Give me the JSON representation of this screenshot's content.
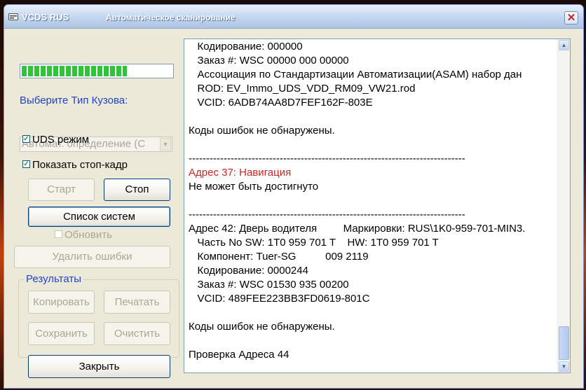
{
  "titlebar": {
    "app_title": "VCDS RUS",
    "window_title": "Автоматическое сканирование",
    "close_symbol": "✕"
  },
  "left_panel": {
    "progress_fraction": 0.7,
    "body_type_label": "Выберите Тип Кузова:",
    "body_type_value": "Автомат. определение (С",
    "uds_mode": {
      "label": "UDS режим",
      "checked": true
    },
    "show_freeze_frame": {
      "label": "Показать стоп-кадр",
      "checked": true
    },
    "start_label": "Старт",
    "stop_label": "Стоп",
    "system_list_label": "Список систем",
    "refresh": {
      "label": "Обновить",
      "checked": false
    },
    "clear_errors_label": "Удалить ошибки",
    "results_label": "Результаты",
    "copy_label": "Копировать",
    "print_label": "Печатать",
    "save_label": "Сохранить",
    "clear_label": "Очистить",
    "close_label": "Закрыть"
  },
  "log": {
    "lines": [
      "   Кодирование: 000000",
      "   Заказ #: WSC 00000 000 00000",
      "   Ассоциация по Стандартизации Автоматизации(ASAM) набор дан",
      "   ROD: EV_Immo_UDS_VDD_RM09_VW21.rod",
      "   VCID: 6ADB74AA8D7FEF162F-803E",
      "",
      "Коды ошибок не обнаружены.",
      "",
      "-------------------------------------------------------------------------------",
      "Адрес 37: Навигация",
      "Не может быть достигнуто",
      "",
      "-------------------------------------------------------------------------------",
      "Адрес 42: Дверь водителя         Маркировки: RUS\\1K0-959-701-MIN3.",
      "   Часть No SW: 1T0 959 701 T    HW: 1T0 959 701 T",
      "   Компонент: Tuer-SG          009 2119",
      "   Кодирование: 0000244",
      "   Заказ #: WSC 01530 935 00200",
      "   VCID: 489FEE223BB3FD0619-801C",
      "",
      "Коды ошибок не обнаружены.",
      "",
      "Проверка Адреса 44"
    ],
    "red_line_index": 9
  },
  "colors": {
    "accent_label": "#1f45c6",
    "log_highlight": "#c62828",
    "progress": "#31c43a"
  }
}
